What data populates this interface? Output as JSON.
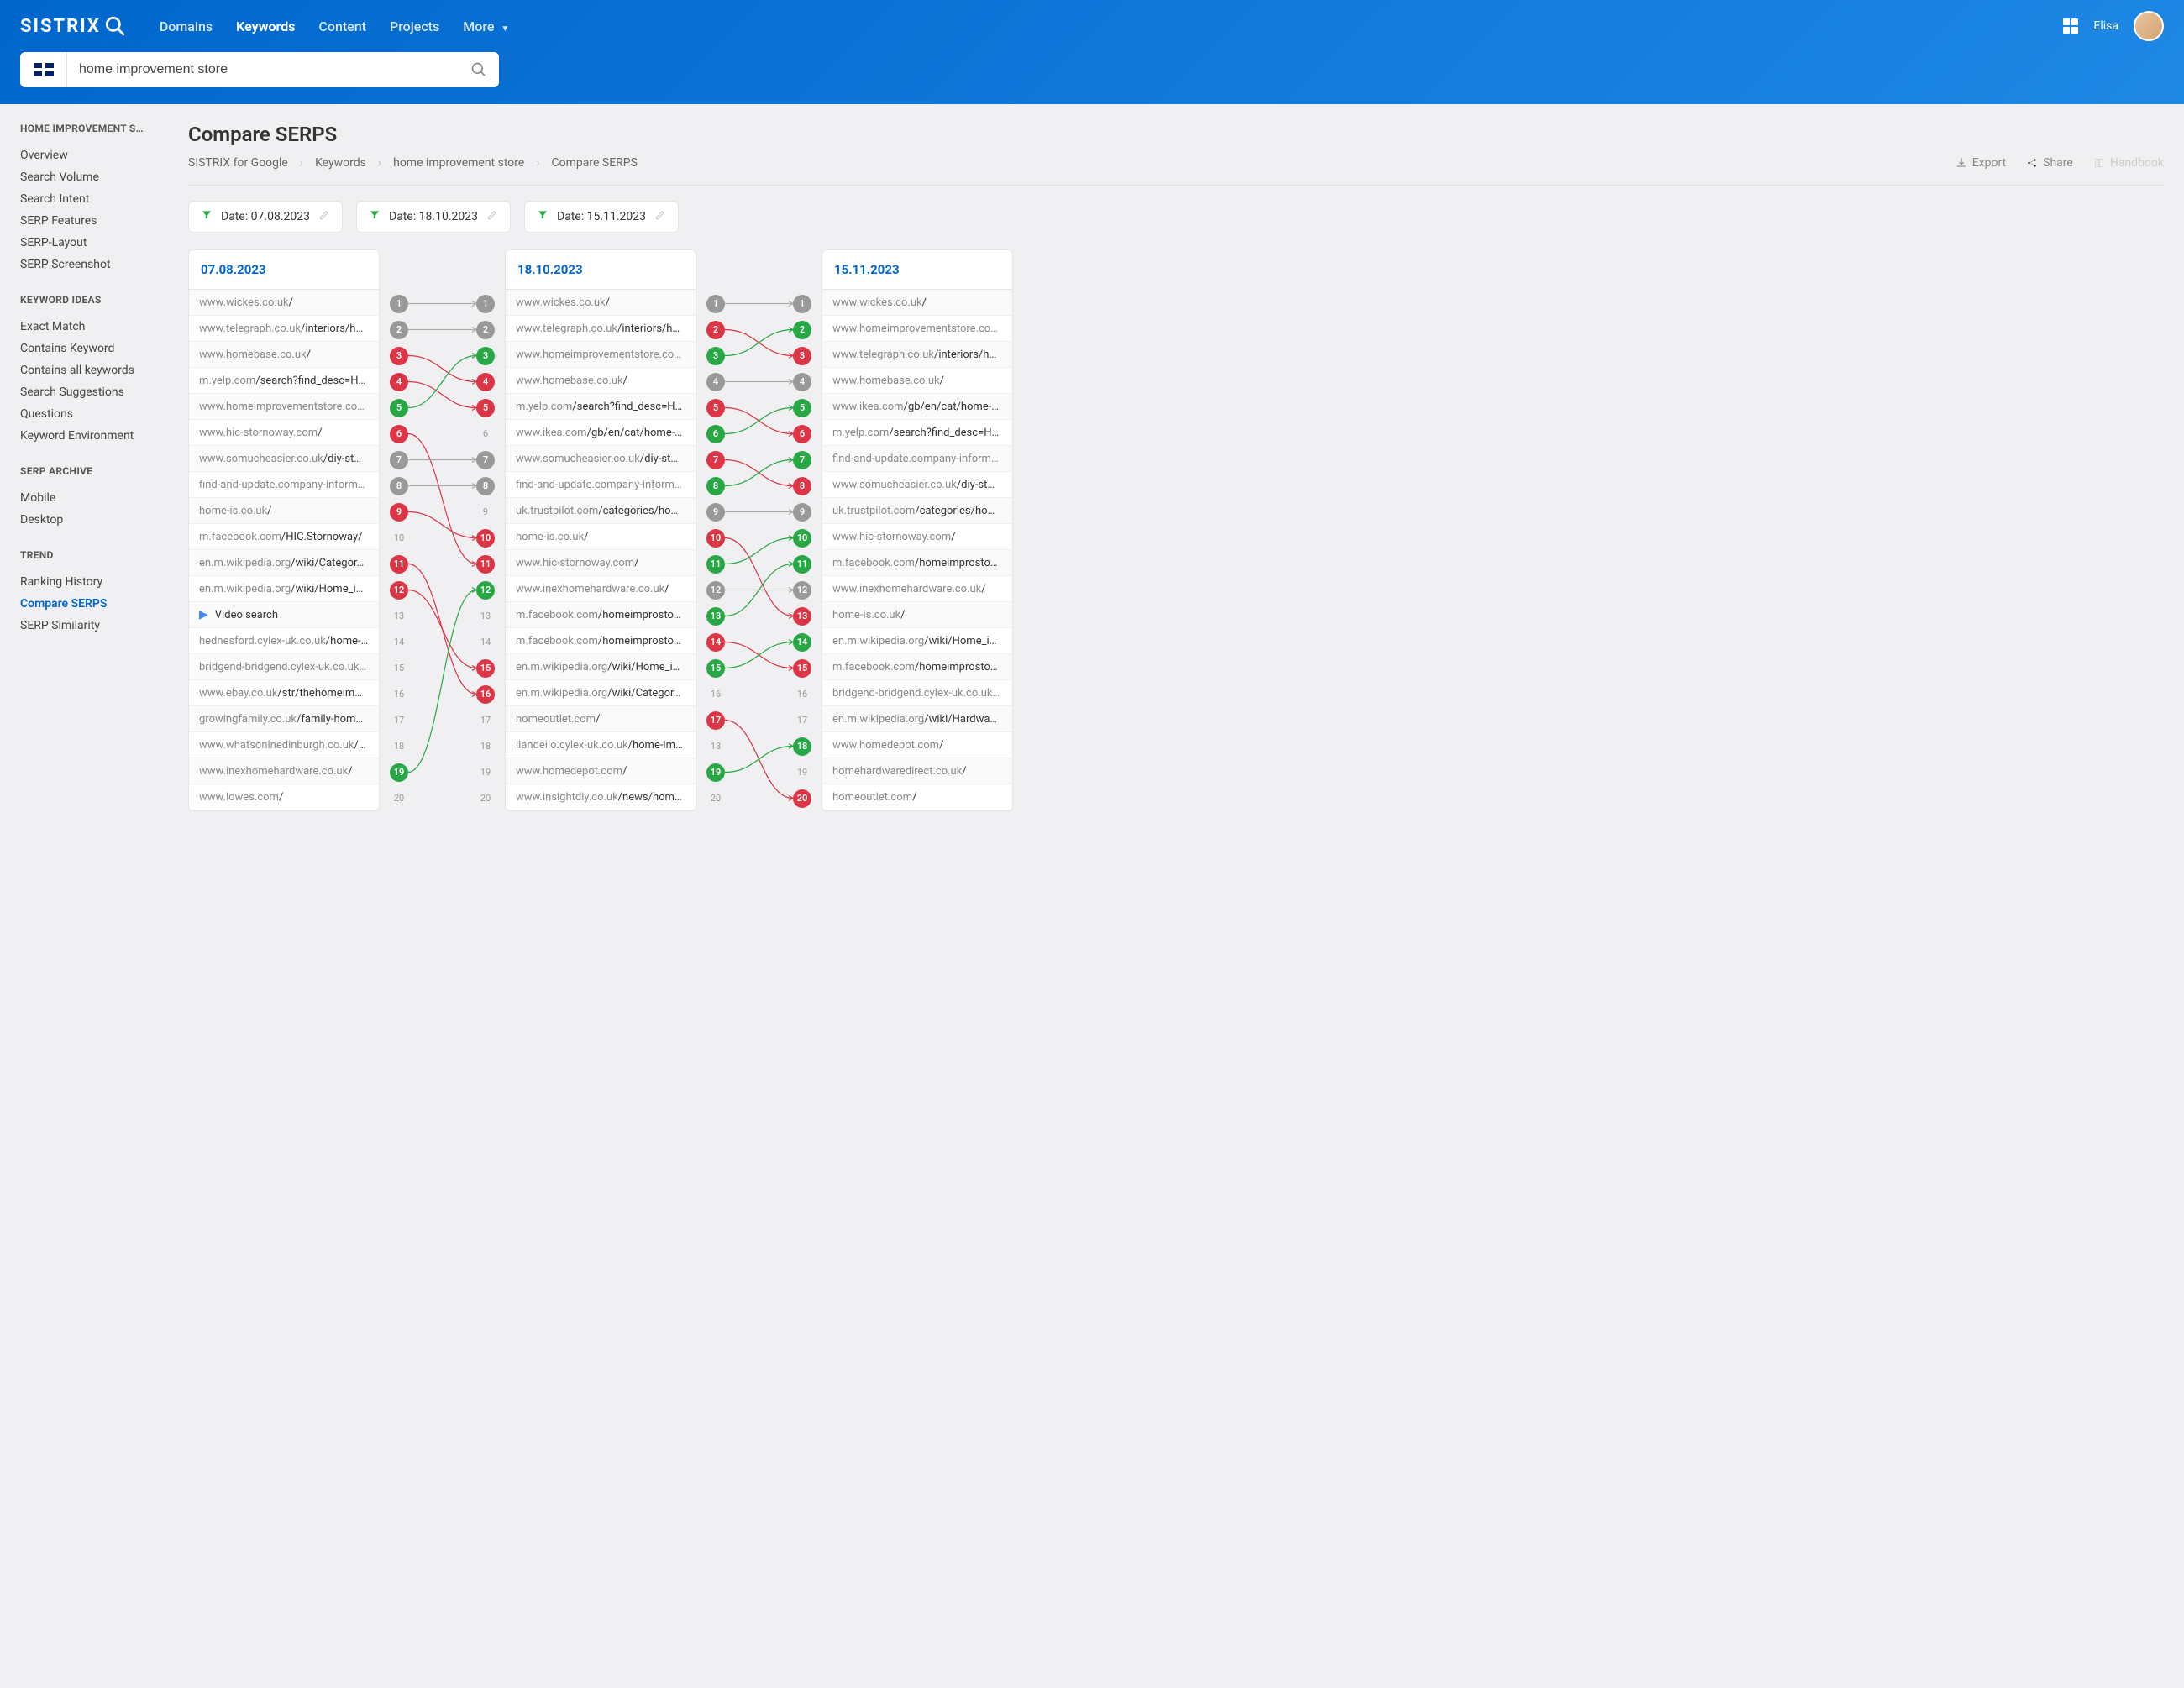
{
  "header": {
    "logo": "SISTRIX",
    "nav": [
      "Domains",
      "Keywords",
      "Content",
      "Projects",
      "More"
    ],
    "nav_active": 1,
    "user": "Elisa",
    "search_value": "home improvement store"
  },
  "sidebar": {
    "title": "HOME IMPROVEMENT S…",
    "groups": [
      {
        "title": "HOME IMPROVEMENT S…",
        "items": [
          "Overview",
          "Search Volume",
          "Search Intent",
          "SERP Features",
          "SERP-Layout",
          "SERP Screenshot"
        ]
      },
      {
        "title": "KEYWORD IDEAS",
        "items": [
          "Exact Match",
          "Contains Keyword",
          "Contains all keywords",
          "Search Suggestions",
          "Questions",
          "Keyword Environment"
        ]
      },
      {
        "title": "SERP ARCHIVE",
        "items": [
          "Mobile",
          "Desktop"
        ]
      },
      {
        "title": "TREND",
        "items": [
          "Ranking History",
          "Compare SERPS",
          "SERP Similarity"
        ]
      }
    ],
    "active": "Compare SERPS"
  },
  "page": {
    "title": "Compare SERPS",
    "breadcrumb": [
      "SISTRIX for Google",
      "Keywords",
      "home improvement store",
      "Compare SERPS"
    ],
    "actions": {
      "export": "Export",
      "share": "Share",
      "handbook": "Handbook"
    },
    "dates": [
      "Date: 07.08.2023",
      "Date: 18.10.2023",
      "Date: 15.11.2023"
    ]
  },
  "columns": [
    {
      "date": "07.08.2023",
      "rows": [
        {
          "dom": "www.wickes.co.uk",
          "path": "/"
        },
        {
          "dom": "www.telegraph.co.uk",
          "path": "/interiors/h…"
        },
        {
          "dom": "www.homebase.co.uk",
          "path": "/"
        },
        {
          "dom": "m.yelp.com",
          "path": "/search?find_desc=H…"
        },
        {
          "dom": "www.homeimprovementstore.co…",
          "path": ""
        },
        {
          "dom": "www.hic-stornoway.com",
          "path": "/"
        },
        {
          "dom": "www.somucheasier.co.uk",
          "path": "/diy-st…"
        },
        {
          "dom": "find-and-update.company-inform…",
          "path": ""
        },
        {
          "dom": "home-is.co.uk",
          "path": "/"
        },
        {
          "dom": "m.facebook.com",
          "path": "/HIC.Stornoway/"
        },
        {
          "dom": "en.m.wikipedia.org",
          "path": "/wiki/Categor…"
        },
        {
          "dom": "en.m.wikipedia.org",
          "path": "/wiki/Home_i…"
        },
        {
          "video": true,
          "label": "Video search"
        },
        {
          "dom": "hednesford.cylex-uk.co.uk",
          "path": "/home-…"
        },
        {
          "dom": "bridgend-bridgend.cylex-uk.co.uk…",
          "path": ""
        },
        {
          "dom": "www.ebay.co.uk",
          "path": "/str/thehomeim…"
        },
        {
          "dom": "growingfamily.co.uk",
          "path": "/family-hom…"
        },
        {
          "dom": "www.whatsoninedinburgh.co.uk",
          "path": "/…"
        },
        {
          "dom": "www.inexhomehardware.co.uk",
          "path": "/"
        },
        {
          "dom": "www.lowes.com",
          "path": "/"
        }
      ]
    },
    {
      "date": "18.10.2023",
      "rows": [
        {
          "dom": "www.wickes.co.uk",
          "path": "/"
        },
        {
          "dom": "www.telegraph.co.uk",
          "path": "/interiors/h…"
        },
        {
          "dom": "www.homeimprovementstore.co…",
          "path": ""
        },
        {
          "dom": "www.homebase.co.uk",
          "path": "/"
        },
        {
          "dom": "m.yelp.com",
          "path": "/search?find_desc=H…"
        },
        {
          "dom": "www.ikea.com",
          "path": "/gb/en/cat/home-…"
        },
        {
          "dom": "www.somucheasier.co.uk",
          "path": "/diy-st…"
        },
        {
          "dom": "find-and-update.company-inform…",
          "path": ""
        },
        {
          "dom": "uk.trustpilot.com",
          "path": "/categories/ho…"
        },
        {
          "dom": "home-is.co.uk",
          "path": "/"
        },
        {
          "dom": "www.hic-stornoway.com",
          "path": "/"
        },
        {
          "dom": "www.inexhomehardware.co.uk",
          "path": "/"
        },
        {
          "dom": "m.facebook.com",
          "path": "/homeimprosto…"
        },
        {
          "dom": "m.facebook.com",
          "path": "/homeimprosto…"
        },
        {
          "dom": "en.m.wikipedia.org",
          "path": "/wiki/Home_i…"
        },
        {
          "dom": "en.m.wikipedia.org",
          "path": "/wiki/Categor…"
        },
        {
          "dom": "homeoutlet.com",
          "path": "/"
        },
        {
          "dom": "llandeilo.cylex-uk.co.uk",
          "path": "/home-im…"
        },
        {
          "dom": "www.homedepot.com",
          "path": "/"
        },
        {
          "dom": "www.insightdiy.co.uk",
          "path": "/news/hom…"
        }
      ]
    },
    {
      "date": "15.11.2023",
      "rows": [
        {
          "dom": "www.wickes.co.uk",
          "path": "/"
        },
        {
          "dom": "www.homeimprovementstore.co…",
          "path": ""
        },
        {
          "dom": "www.telegraph.co.uk",
          "path": "/interiors/h…"
        },
        {
          "dom": "www.homebase.co.uk",
          "path": "/"
        },
        {
          "dom": "www.ikea.com",
          "path": "/gb/en/cat/home-…"
        },
        {
          "dom": "m.yelp.com",
          "path": "/search?find_desc=H…"
        },
        {
          "dom": "find-and-update.company-inform…",
          "path": ""
        },
        {
          "dom": "www.somucheasier.co.uk",
          "path": "/diy-st…"
        },
        {
          "dom": "uk.trustpilot.com",
          "path": "/categories/ho…"
        },
        {
          "dom": "www.hic-stornoway.com",
          "path": "/"
        },
        {
          "dom": "m.facebook.com",
          "path": "/homeimprosto…"
        },
        {
          "dom": "www.inexhomehardware.co.uk",
          "path": "/"
        },
        {
          "dom": "home-is.co.uk",
          "path": "/"
        },
        {
          "dom": "en.m.wikipedia.org",
          "path": "/wiki/Home_i…"
        },
        {
          "dom": "m.facebook.com",
          "path": "/homeimprosto…"
        },
        {
          "dom": "bridgend-bridgend.cylex-uk.co.uk…",
          "path": ""
        },
        {
          "dom": "en.m.wikipedia.org",
          "path": "/wiki/Hardwa…"
        },
        {
          "dom": "www.homedepot.com",
          "path": "/"
        },
        {
          "dom": "homehardwaredirect.co.uk",
          "path": "/"
        },
        {
          "dom": "homeoutlet.com",
          "path": "/"
        }
      ]
    }
  ],
  "arrows": [
    {
      "left": [
        {
          "n": 1,
          "c": "gray"
        },
        {
          "n": 2,
          "c": "gray"
        },
        {
          "n": 3,
          "c": "red"
        },
        {
          "n": 4,
          "c": "red"
        },
        {
          "n": 5,
          "c": "green"
        },
        {
          "n": 6,
          "c": "red"
        },
        {
          "n": 7,
          "c": "gray"
        },
        {
          "n": 8,
          "c": "gray"
        },
        {
          "n": 9,
          "c": "red"
        },
        {
          "n": 10,
          "c": "plain"
        },
        {
          "n": 11,
          "c": "red"
        },
        {
          "n": 12,
          "c": "red"
        },
        {
          "n": 13,
          "c": "plain"
        },
        {
          "n": 14,
          "c": "plain"
        },
        {
          "n": 15,
          "c": "plain"
        },
        {
          "n": 16,
          "c": "plain"
        },
        {
          "n": 17,
          "c": "plain"
        },
        {
          "n": 18,
          "c": "plain"
        },
        {
          "n": 19,
          "c": "green"
        },
        {
          "n": 20,
          "c": "plain"
        }
      ],
      "right": [
        {
          "n": 1,
          "c": "gray"
        },
        {
          "n": 2,
          "c": "gray"
        },
        {
          "n": 3,
          "c": "green"
        },
        {
          "n": 4,
          "c": "red"
        },
        {
          "n": 5,
          "c": "red"
        },
        {
          "n": 6,
          "c": "plain"
        },
        {
          "n": 7,
          "c": "gray"
        },
        {
          "n": 8,
          "c": "gray"
        },
        {
          "n": 9,
          "c": "plain"
        },
        {
          "n": 10,
          "c": "red"
        },
        {
          "n": 11,
          "c": "red"
        },
        {
          "n": 12,
          "c": "green"
        },
        {
          "n": 13,
          "c": "plain"
        },
        {
          "n": 14,
          "c": "plain"
        },
        {
          "n": 15,
          "c": "red"
        },
        {
          "n": 16,
          "c": "red"
        },
        {
          "n": 17,
          "c": "plain"
        },
        {
          "n": 18,
          "c": "plain"
        },
        {
          "n": 19,
          "c": "plain"
        },
        {
          "n": 20,
          "c": "plain"
        }
      ],
      "links": [
        {
          "from": 1,
          "to": 1,
          "c": "gray"
        },
        {
          "from": 2,
          "to": 2,
          "c": "gray"
        },
        {
          "from": 3,
          "to": 4,
          "c": "red"
        },
        {
          "from": 4,
          "to": 5,
          "c": "red"
        },
        {
          "from": 5,
          "to": 3,
          "c": "green"
        },
        {
          "from": 6,
          "to": 11,
          "c": "red"
        },
        {
          "from": 7,
          "to": 7,
          "c": "gray"
        },
        {
          "from": 8,
          "to": 8,
          "c": "gray"
        },
        {
          "from": 9,
          "to": 10,
          "c": "red"
        },
        {
          "from": 11,
          "to": 16,
          "c": "red"
        },
        {
          "from": 12,
          "to": 15,
          "c": "red"
        },
        {
          "from": 19,
          "to": 12,
          "c": "green"
        }
      ]
    },
    {
      "left": [
        {
          "n": 1,
          "c": "gray"
        },
        {
          "n": 2,
          "c": "red"
        },
        {
          "n": 3,
          "c": "green"
        },
        {
          "n": 4,
          "c": "gray"
        },
        {
          "n": 5,
          "c": "red"
        },
        {
          "n": 6,
          "c": "green"
        },
        {
          "n": 7,
          "c": "red"
        },
        {
          "n": 8,
          "c": "green"
        },
        {
          "n": 9,
          "c": "gray"
        },
        {
          "n": 10,
          "c": "red"
        },
        {
          "n": 11,
          "c": "green"
        },
        {
          "n": 12,
          "c": "gray"
        },
        {
          "n": 13,
          "c": "green"
        },
        {
          "n": 14,
          "c": "red"
        },
        {
          "n": 15,
          "c": "green"
        },
        {
          "n": 16,
          "c": "plain"
        },
        {
          "n": 17,
          "c": "red"
        },
        {
          "n": 18,
          "c": "plain"
        },
        {
          "n": 19,
          "c": "green"
        },
        {
          "n": 20,
          "c": "plain"
        }
      ],
      "right": [
        {
          "n": 1,
          "c": "gray"
        },
        {
          "n": 2,
          "c": "green"
        },
        {
          "n": 3,
          "c": "red"
        },
        {
          "n": 4,
          "c": "gray"
        },
        {
          "n": 5,
          "c": "green"
        },
        {
          "n": 6,
          "c": "red"
        },
        {
          "n": 7,
          "c": "green"
        },
        {
          "n": 8,
          "c": "red"
        },
        {
          "n": 9,
          "c": "gray"
        },
        {
          "n": 10,
          "c": "green"
        },
        {
          "n": 11,
          "c": "green"
        },
        {
          "n": 12,
          "c": "gray"
        },
        {
          "n": 13,
          "c": "red"
        },
        {
          "n": 14,
          "c": "green"
        },
        {
          "n": 15,
          "c": "red"
        },
        {
          "n": 16,
          "c": "plain"
        },
        {
          "n": 17,
          "c": "plain"
        },
        {
          "n": 18,
          "c": "green"
        },
        {
          "n": 19,
          "c": "plain"
        },
        {
          "n": 20,
          "c": "red"
        }
      ],
      "links": [
        {
          "from": 1,
          "to": 1,
          "c": "gray"
        },
        {
          "from": 2,
          "to": 3,
          "c": "red"
        },
        {
          "from": 3,
          "to": 2,
          "c": "green"
        },
        {
          "from": 4,
          "to": 4,
          "c": "gray"
        },
        {
          "from": 5,
          "to": 6,
          "c": "red"
        },
        {
          "from": 6,
          "to": 5,
          "c": "green"
        },
        {
          "from": 7,
          "to": 8,
          "c": "red"
        },
        {
          "from": 8,
          "to": 7,
          "c": "green"
        },
        {
          "from": 9,
          "to": 9,
          "c": "gray"
        },
        {
          "from": 10,
          "to": 13,
          "c": "red"
        },
        {
          "from": 11,
          "to": 10,
          "c": "green"
        },
        {
          "from": 12,
          "to": 12,
          "c": "gray"
        },
        {
          "from": 13,
          "to": 11,
          "c": "green"
        },
        {
          "from": 14,
          "to": 15,
          "c": "red"
        },
        {
          "from": 15,
          "to": 14,
          "c": "green"
        },
        {
          "from": 17,
          "to": 20,
          "c": "red"
        },
        {
          "from": 19,
          "to": 18,
          "c": "green"
        }
      ]
    }
  ]
}
